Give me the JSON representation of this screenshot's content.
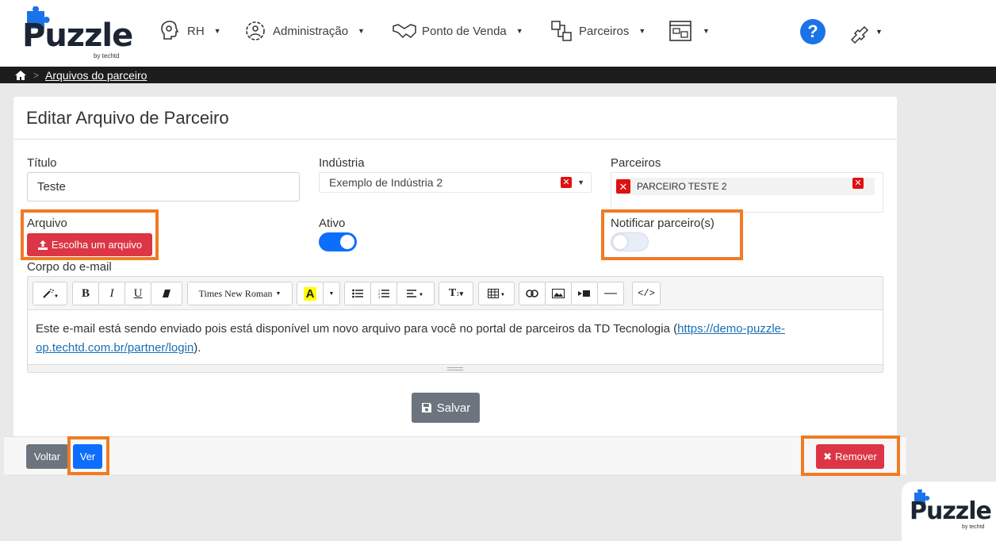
{
  "brand": {
    "name": "Puzzle",
    "sub": "by techtd"
  },
  "nav": {
    "items": [
      {
        "label": "RH",
        "icon": "head-gear-icon"
      },
      {
        "label": "Administração",
        "icon": "cog-person-icon"
      },
      {
        "label": "Ponto de Venda",
        "icon": "handshake-icon"
      },
      {
        "label": "Parceiros",
        "icon": "partners-puzzle-icon"
      },
      {
        "label": "",
        "icon": "dashboard-window-icon"
      }
    ],
    "help": "?"
  },
  "breadcrumb": {
    "current": "Arquivos do parceiro"
  },
  "card": {
    "title": "Editar Arquivo de Parceiro"
  },
  "form": {
    "titulo": {
      "label": "Título",
      "value": "Teste"
    },
    "industria": {
      "label": "Indústria",
      "value": "Exemplo de Indústria 2"
    },
    "parceiros": {
      "label": "Parceiros",
      "chip": "PARCEIRO TESTE 2"
    },
    "arquivo": {
      "label": "Arquivo",
      "button": "Escolha um arquivo"
    },
    "ativo": {
      "label": "Ativo",
      "on": true
    },
    "notificar": {
      "label": "Notificar parceiro(s)",
      "on": false
    },
    "corpo": {
      "label": "Corpo do e-mail"
    }
  },
  "editor": {
    "font": "Times New Roman",
    "text_before": "Este e-mail está sendo enviado pois está disponível um novo arquivo para você no portal de parceiros da TD Tecnologia (",
    "link": "https://demo-puzzle-op.techtd.com.br/partner/login",
    "text_after": ")."
  },
  "actions": {
    "save": "Salvar",
    "back": "Voltar",
    "view": "Ver",
    "remove": "Remover"
  },
  "colors": {
    "primary": "#0d6efd",
    "danger": "#dc3545",
    "secondary": "#6c757d",
    "highlight": "#f07b24"
  }
}
